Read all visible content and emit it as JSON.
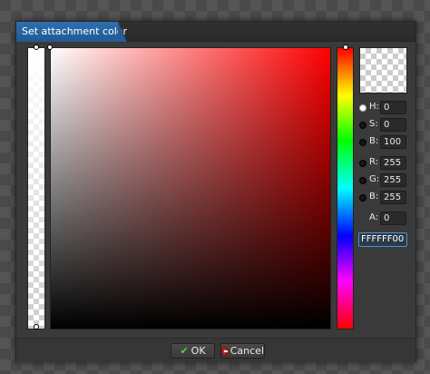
{
  "dialog": {
    "title": "Set attachment color",
    "preview_color": "#FFFFFF",
    "selected_mode": "H"
  },
  "fields": [
    {
      "label": "H:",
      "value": "0"
    },
    {
      "label": "S:",
      "value": "0"
    },
    {
      "label": "B:",
      "value": "100"
    },
    {
      "label": "R:",
      "value": "255"
    },
    {
      "label": "G:",
      "value": "255"
    },
    {
      "label": "B:",
      "value": "255"
    },
    {
      "label": "A:",
      "value": "0"
    }
  ],
  "hex_value": "FFFFFF00",
  "buttons": {
    "ok_label": "OK",
    "cancel_label": "Cancel"
  },
  "colors": {
    "hue_base": "#FF0000",
    "title_accent": "#2F6FB0"
  }
}
